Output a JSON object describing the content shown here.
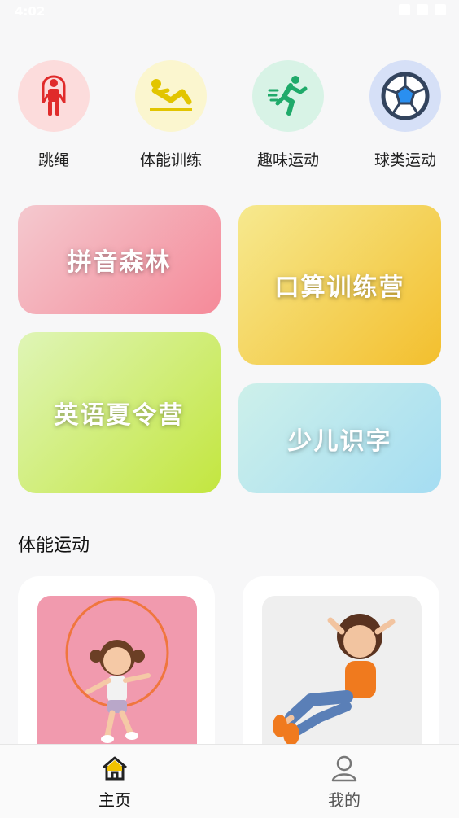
{
  "status_bar": {
    "time": "4:02"
  },
  "categories": [
    {
      "label": "跳绳",
      "icon": "jump-rope-icon",
      "bg": "#fcdcdc"
    },
    {
      "label": "体能训练",
      "icon": "situp-icon",
      "bg": "#fbf6cf"
    },
    {
      "label": "趣味运动",
      "icon": "runner-icon",
      "bg": "#d8f3e6"
    },
    {
      "label": "球类运动",
      "icon": "soccer-ball-icon",
      "bg": "#d6e0f7"
    }
  ],
  "courses": [
    {
      "title": "拼音森林"
    },
    {
      "title": "口算训练营"
    },
    {
      "title": "英语夏令营"
    },
    {
      "title": "少儿识字"
    }
  ],
  "section": {
    "title": "体能运动"
  },
  "exercises": [
    {
      "name": "girl-jumping-rope-image"
    },
    {
      "name": "girl-doing-situps-image"
    }
  ],
  "bottom_nav": {
    "home_label": "主页",
    "mine_label": "我的"
  },
  "colors": {
    "accent_yellow": "#f2c200",
    "nav_active": "#111111",
    "nav_inactive": "#555555"
  }
}
